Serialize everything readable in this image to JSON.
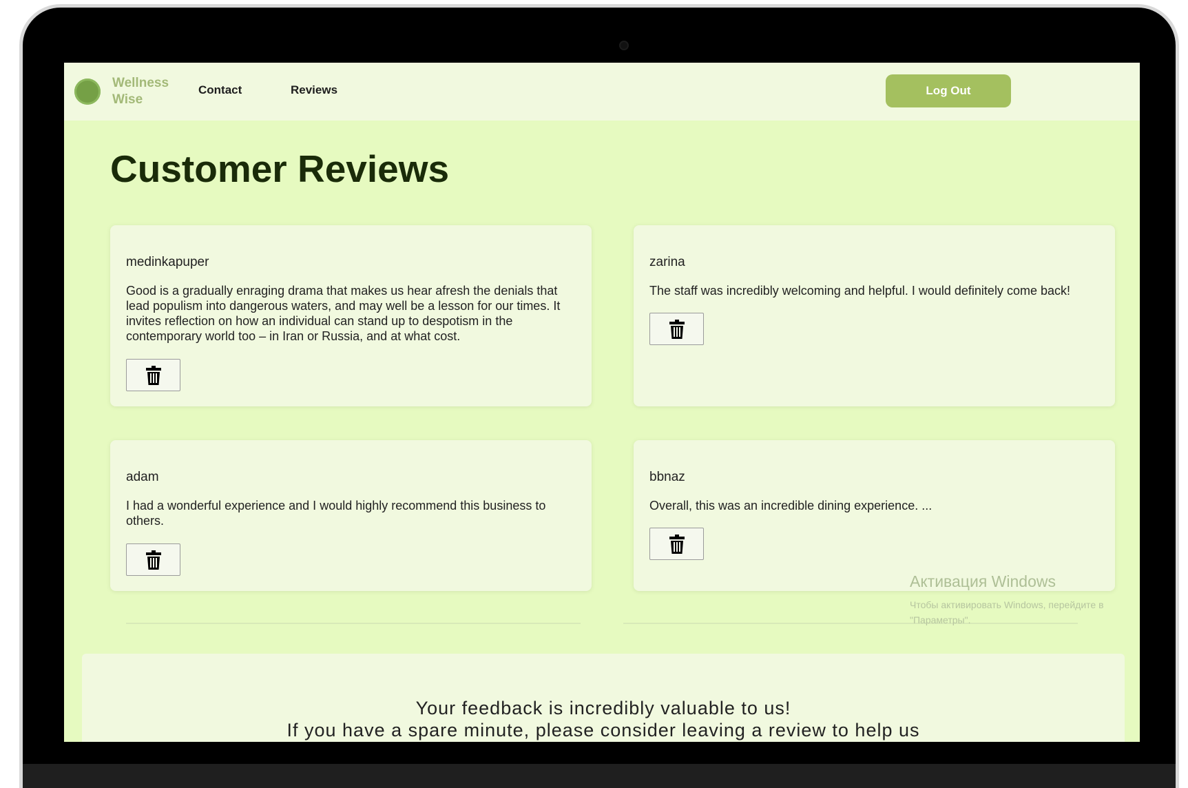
{
  "navbar": {
    "brand": "Wellness Wise",
    "links": [
      "Contact",
      "Reviews"
    ],
    "logout_label": "Log Out"
  },
  "page": {
    "title": "Customer Reviews"
  },
  "reviews": [
    {
      "username": "medinkapuper",
      "text": "Good is a gradually enraging drama that makes us hear afresh the denials that lead populism into dangerous waters, and may well be a lesson for our times. It invites reflection on how an individual can stand up to despotism in the contemporary world too – in Iran or Russia, and at what cost."
    },
    {
      "username": "zarina",
      "text": "The staff was incredibly welcoming and helpful. I would definitely come back!"
    },
    {
      "username": "adam",
      "text": "I had a wonderful experience and I would highly recommend this business to others."
    },
    {
      "username": "bbnaz",
      "text": "Overall, this was an incredible dining experience. ..."
    }
  ],
  "watermark": {
    "title": "Активация Windows",
    "line1": "Чтобы активировать Windows, перейдите в",
    "line2": "\"Параметры\"."
  },
  "feedback": {
    "line1": "Your feedback is incredibly valuable to us!",
    "line2": "If you have a spare minute, please consider leaving a review to help us"
  },
  "colors": {
    "page_bg": "#e6fac0",
    "nav_bg": "#f1f9df",
    "accent": "#a4c05f",
    "logo": "#75a046"
  }
}
